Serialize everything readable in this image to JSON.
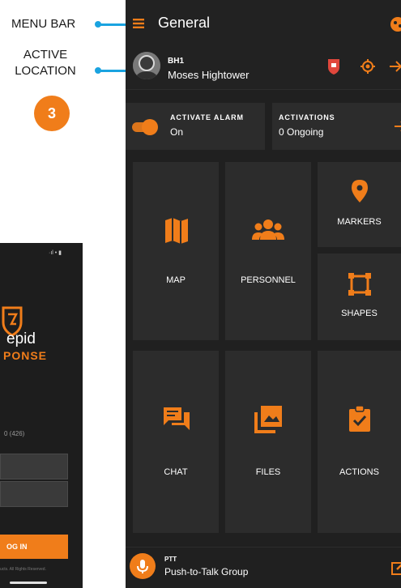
{
  "callouts": {
    "menu_bar": "MENU BAR",
    "active_location_1": "ACTIVE",
    "active_location_2": "LOCATION",
    "step_number": "3"
  },
  "login_screen": {
    "status_icons": "·ıl • ▮",
    "title_line1": "epid",
    "title_line2": "PONSE",
    "phone_label": "0 (426)",
    "login_button": "OG IN",
    "copyright": "ucts. All Rights Reserved."
  },
  "header": {
    "title": "General"
  },
  "user": {
    "code": "BH1",
    "name": "Moses Hightower"
  },
  "alarm": {
    "label": "ACTIVATE ALARM",
    "value": "On"
  },
  "activations": {
    "label": "ACTIVATIONS",
    "value": "0 Ongoing"
  },
  "tiles": {
    "map": "MAP",
    "personnel": "PERSONNEL",
    "markers": "MARKERS",
    "shapes": "SHAPES",
    "chat": "CHAT",
    "files": "FILES",
    "actions": "ACTIONS"
  },
  "ptt": {
    "label": "PTT",
    "group": "Push-to-Talk Group"
  },
  "colors": {
    "accent": "#f07d1a",
    "callout": "#1aa3e0",
    "background": "#202020",
    "tile": "#2c2c2c"
  },
  "icons": [
    "menu-icon",
    "location-target-icon",
    "arrow-right-icon",
    "map-icon",
    "group-icon",
    "map-pin-icon",
    "square-shape-icon",
    "chat-icon",
    "image-icon",
    "clipboard-check-icon",
    "microphone-icon",
    "edit-icon"
  ]
}
